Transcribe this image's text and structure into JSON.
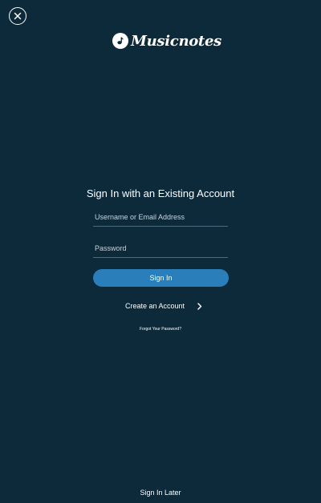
{
  "header": {
    "brand_name": "Musicnotes"
  },
  "icons": {
    "close": "close-icon",
    "logo": "music-note-logo-icon",
    "chevron": "chevron-right-icon"
  },
  "colors": {
    "background": "#0c2a3a",
    "primary_button": "#2a7fba",
    "field_underline": "#4b6c7c"
  },
  "form": {
    "title": "Sign In with an Existing Account",
    "username_placeholder": "Username or Email Address",
    "username_value": "",
    "password_placeholder": "Password",
    "password_value": "",
    "sign_in_label": "Sign In",
    "create_account_label": "Create an Account",
    "forgot_password_label": "Forgot Your Password?"
  },
  "footer": {
    "sign_in_later_label": "Sign In Later"
  }
}
